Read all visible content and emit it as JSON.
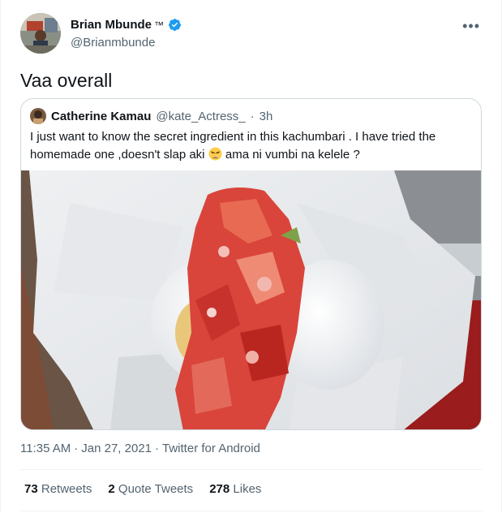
{
  "author": {
    "name": "Brian Mbunde",
    "tm": "™",
    "handle": "@Brianmbunde"
  },
  "tweet": {
    "text": "Vaa overall"
  },
  "quoted": {
    "name": "Catherine Kamau",
    "handle": "@kate_Actress_",
    "dot": "·",
    "time": "3h",
    "text_part1": "I just want to know the secret ingredient in this kachumbari . I have tried the homemade one ,doesn't slap aki",
    "text_part2": "ama ni vumbi na kelele ?"
  },
  "meta": {
    "time": "11:35 AM",
    "sep1": "·",
    "date": "Jan 27, 2021",
    "sep2": "·",
    "source": "Twitter for Android"
  },
  "stats": {
    "retweets_count": "73",
    "retweets_label": "Retweets",
    "quotes_count": "2",
    "quotes_label": "Quote Tweets",
    "likes_count": "278",
    "likes_label": "Likes"
  },
  "icons": {
    "verified": "verified-badge-icon",
    "more": "more-options-icon",
    "emoji": "weary-face-emoji"
  },
  "colors": {
    "verified_blue": "#1d9bf0",
    "secondary_text": "#536471",
    "border": "#cfd9de"
  }
}
